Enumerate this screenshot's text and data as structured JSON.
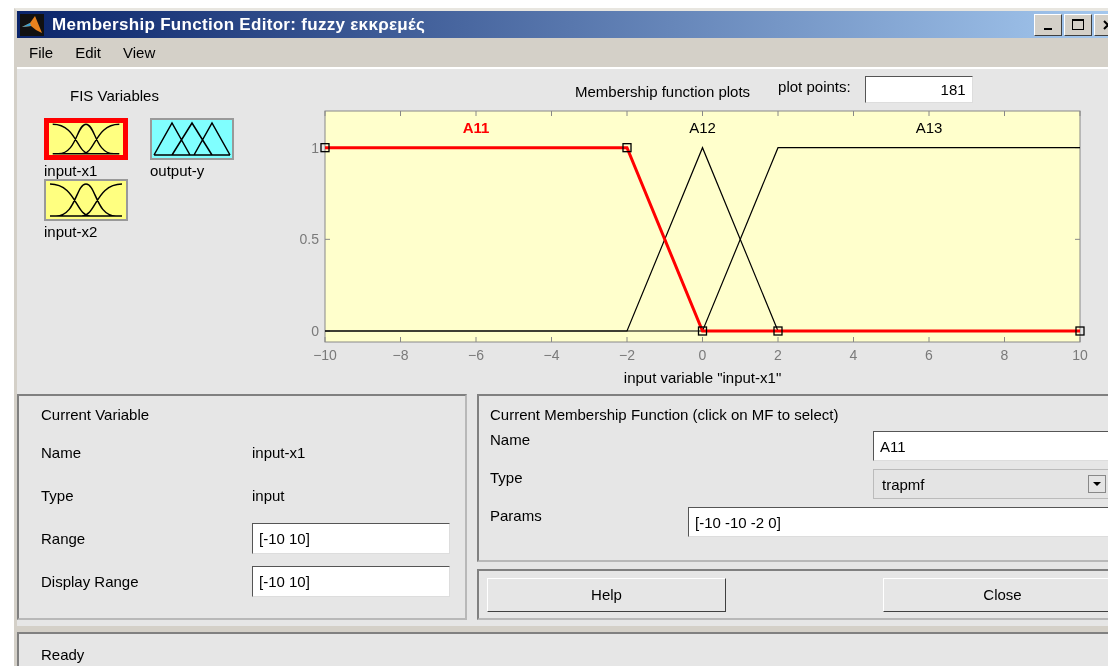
{
  "window": {
    "title": "Membership Function Editor: fuzzy εκκρεμές"
  },
  "menu": [
    {
      "label": "File"
    },
    {
      "label": "Edit"
    },
    {
      "label": "View"
    }
  ],
  "fis_variables": {
    "title": "FIS Variables",
    "items": [
      {
        "label": "input-x1",
        "kind": "input",
        "selected": true
      },
      {
        "label": "output-y",
        "kind": "output",
        "selected": false
      },
      {
        "label": "input-x2",
        "kind": "input",
        "selected": false
      }
    ]
  },
  "plot": {
    "title": "Membership function plots",
    "plot_points_label": "plot points:",
    "plot_points": "181",
    "chart_data": {
      "type": "line",
      "xlabel": "input variable \"input-x1\"",
      "x": [
        -10,
        -2,
        0,
        2,
        10
      ],
      "xlim": [
        -10,
        10
      ],
      "ylim": [
        -0.06,
        1.2
      ],
      "xticks": [
        -10,
        -8,
        -6,
        -4,
        -2,
        0,
        2,
        4,
        6,
        8,
        10
      ],
      "yticks": [
        0,
        0.5,
        1
      ],
      "series": [
        {
          "name": "A11",
          "color": "#ff0000",
          "values": [
            1,
            1,
            0,
            0,
            0
          ]
        },
        {
          "name": "A12",
          "color": "#000000",
          "values": [
            0,
            0,
            1,
            0,
            null
          ]
        },
        {
          "name": "A13",
          "color": "#000000",
          "values": [
            0,
            0,
            0,
            1,
            1
          ]
        }
      ]
    },
    "membership_functions": [
      {
        "selected": true
      },
      {
        "selected": false
      },
      {
        "selected": false
      }
    ]
  },
  "current_variable": {
    "title": "Current Variable",
    "name_label": "Name",
    "name": "input-x1",
    "type_label": "Type",
    "type": "input",
    "range_label": "Range",
    "range": "[-10 10]",
    "display_range_label": "Display Range",
    "display_range": "[-10 10]"
  },
  "current_mf": {
    "title": "Current Membership Function (click on MF to select)",
    "name_label": "Name",
    "name": "A11",
    "type_label": "Type",
    "type": "trapmf",
    "params_label": "Params",
    "params": "[-10 -10 -2 0]"
  },
  "buttons": [
    {
      "label": "Help"
    },
    {
      "label": "Close"
    }
  ],
  "status_bar": "Ready"
}
